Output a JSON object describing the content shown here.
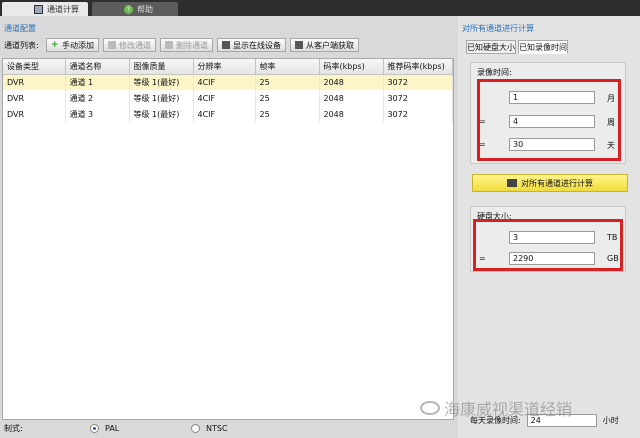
{
  "tabs": [
    {
      "label": "通道计算"
    },
    {
      "label": "帮助"
    }
  ],
  "left": {
    "group_title": "通道配置",
    "toolbar": {
      "label": "通道列表:",
      "add": "手动添加",
      "modify": "修改通道",
      "delete": "删除通道",
      "show_online": "显示在线设备",
      "from_client": "从客户端获取"
    },
    "table": {
      "headers": [
        "设备类型",
        "通道名称",
        "图像质量",
        "分辨率",
        "帧率",
        "码率(kbps)",
        "推荐码率(kbps)"
      ],
      "rows": [
        [
          "DVR",
          "通道 1",
          "等级 1(最好)",
          "4CIF",
          "25",
          "2048",
          "3072"
        ],
        [
          "DVR",
          "通道 2",
          "等级 1(最好)",
          "4CIF",
          "25",
          "2048",
          "3072"
        ],
        [
          "DVR",
          "通道 3",
          "等级 1(最好)",
          "4CIF",
          "25",
          "2048",
          "3072"
        ]
      ]
    },
    "standard": {
      "label": "制式:",
      "pal": "PAL",
      "ntsc": "NTSC"
    }
  },
  "right": {
    "group_title": "对所有通道进行计算",
    "subtabs": [
      "已知硬盘大小",
      "已知录像时间"
    ],
    "record_time": {
      "title": "录像时间:",
      "months": "1",
      "months_unit": "月",
      "weeks": "4",
      "weeks_unit": "周",
      "days": "30",
      "days_unit": "天",
      "eq": "="
    },
    "calc_button": "对所有通道进行计算",
    "disk": {
      "title": "硬盘大小:",
      "tb": "3",
      "tb_unit": "TB",
      "gb": "2290",
      "gb_unit": "GB",
      "eq": "="
    },
    "daily": {
      "label": "每天录像时间:",
      "value": "24",
      "unit": "小时"
    }
  },
  "watermark": "海康威视渠道经销"
}
